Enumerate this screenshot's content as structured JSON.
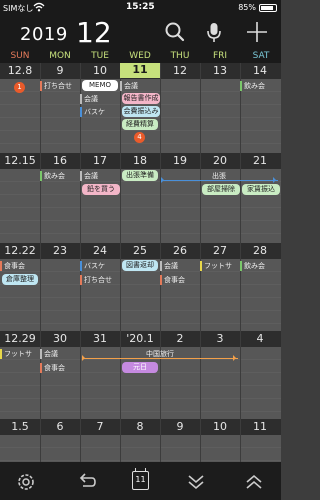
{
  "status": {
    "carrier": "SIMなし",
    "time": "15:25",
    "battery": "85%",
    "battery_level": 0.85
  },
  "header": {
    "year": "2019",
    "month": "12"
  },
  "weekdays": [
    "SUN",
    "MON",
    "TUE",
    "WED",
    "THU",
    "FRI",
    "SAT"
  ],
  "colors": {
    "sun": "#e47a5a",
    "sat": "#7ac8d8",
    "weekday": "#c6e07c",
    "today_bg": "#c6e07c",
    "badge": "#e95b2b"
  },
  "weeks": [
    {
      "days": [
        "12.8",
        "9",
        "10",
        "11",
        "12",
        "13",
        "14"
      ]
    },
    {
      "days": [
        "12.15",
        "16",
        "17",
        "18",
        "19",
        "20",
        "21"
      ]
    },
    {
      "days": [
        "12.22",
        "23",
        "24",
        "25",
        "26",
        "27",
        "28"
      ]
    },
    {
      "days": [
        "12.29",
        "30",
        "31",
        "'20.1",
        "2",
        "3",
        "4"
      ]
    },
    {
      "days": [
        "1.5",
        "6",
        "7",
        "8",
        "9",
        "10",
        "11"
      ]
    }
  ],
  "events": {
    "w1_badge_sun": "1",
    "w1_mon": "打ち合せ",
    "w1_tue_memo": "MEMO",
    "w1_tue_a": "会議",
    "w1_tue_b": "バスケ",
    "w1_wed_a": "会議",
    "w1_wed_b": "報告書作成",
    "w1_wed_c": "会費振込み",
    "w1_wed_d": "経費精算",
    "w1_badge_wed": "4",
    "w1_sat": "飲み会",
    "w2_mon": "飲み会",
    "w2_tue_a": "会議",
    "w2_tue_b": "鉛を買う",
    "w2_wed": "出張準備",
    "w2_trip": "出張",
    "w2_fri": "部屋掃除",
    "w2_sat": "家賃振込",
    "w3_sun_a": "食事会",
    "w3_sun_b": "倉庫整理",
    "w3_tue_a": "バスケ",
    "w3_tue_b": "打ち合せ",
    "w3_wed": "図書返却",
    "w3_thu_a": "会議",
    "w3_thu_b": "食事会",
    "w3_fri": "フットサ",
    "w3_sat": "飲み会",
    "w4_sun": "フットサ",
    "w4_mon_a": "会議",
    "w4_mon_b": "食事会",
    "w4_trip": "中国旅行",
    "w4_newyear": "元日"
  }
}
